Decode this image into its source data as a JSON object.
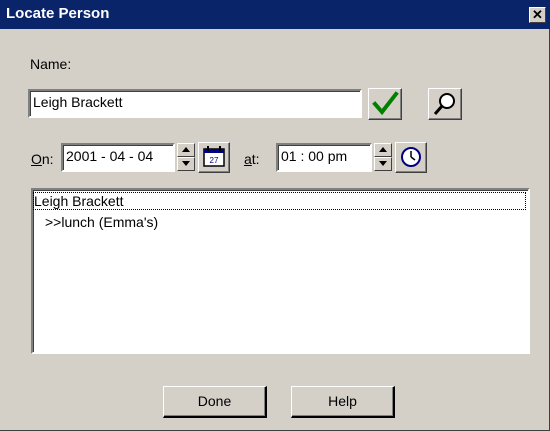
{
  "window": {
    "title": "Locate Person",
    "close_glyph": "✕"
  },
  "name_label": "Name:",
  "name_input": {
    "value": "Leigh Brackett"
  },
  "date": {
    "label_accel": "O",
    "label_rest": "n:",
    "value": "2001 - 04 - 04",
    "calendar_day": "27"
  },
  "time": {
    "label_accel": "a",
    "label_rest": "t:",
    "value": "01 : 00 pm"
  },
  "results": [
    {
      "text": "Leigh Brackett"
    },
    {
      "text": ">>lunch (Emma's)"
    }
  ],
  "buttons": {
    "done": "Done",
    "help": "Help"
  },
  "colors": {
    "titlebar": "#0a246a",
    "dialog_bg": "#d4d0c8",
    "checkmark": "#008000"
  }
}
